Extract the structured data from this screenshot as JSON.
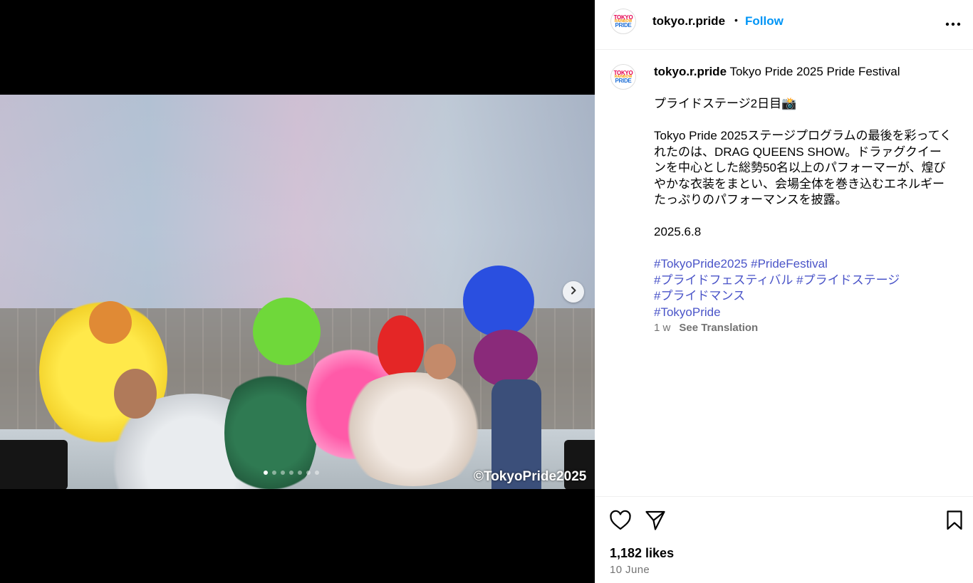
{
  "post": {
    "username": "tokyo.r.pride",
    "separator": "•",
    "follow_label": "Follow",
    "avatar": {
      "line1": "TOKYO",
      "line2": "RAINBOW",
      "line3": "PRIDE"
    },
    "watermark": "©TokyoPride2025",
    "carousel": {
      "total_slides": 7,
      "active_index": 1
    }
  },
  "caption": {
    "username": "tokyo.r.pride",
    "title": "Tokyo Pride 2025 Pride Festival",
    "line1": "プライドステージ2日目📸",
    "body": "Tokyo Pride 2025ステージプログラムの最後を彩ってくれたのは、DRAG QUEENS SHOW。ドラァグクイーンを中心とした総勢50名以上のパフォーマーが、煌びやかな衣装をまとい、会場全体を巻き込むエネルギーたっぷりのパフォーマンスを披露。",
    "date_line": "2025.6.8",
    "hashtags": {
      "tag1": "#TokyoPride2025",
      "tag2": "#PrideFestival",
      "tag3": "#プライドフェスティバル",
      "tag4": "#プライドステージ",
      "tag5": "#プライドマンス",
      "tag6": "#TokyoPride"
    },
    "age": "1 w",
    "see_translation": "See Translation"
  },
  "footer": {
    "likes": "1,182 likes",
    "date": "10 June"
  },
  "icons": {
    "more": "more-horizontal-icon",
    "next": "chevron-right-icon",
    "like": "heart-icon",
    "share": "send-icon",
    "save": "bookmark-icon"
  },
  "colors": {
    "follow": "#0095f6",
    "hashtag": "#4a54c8",
    "muted": "#737373"
  }
}
